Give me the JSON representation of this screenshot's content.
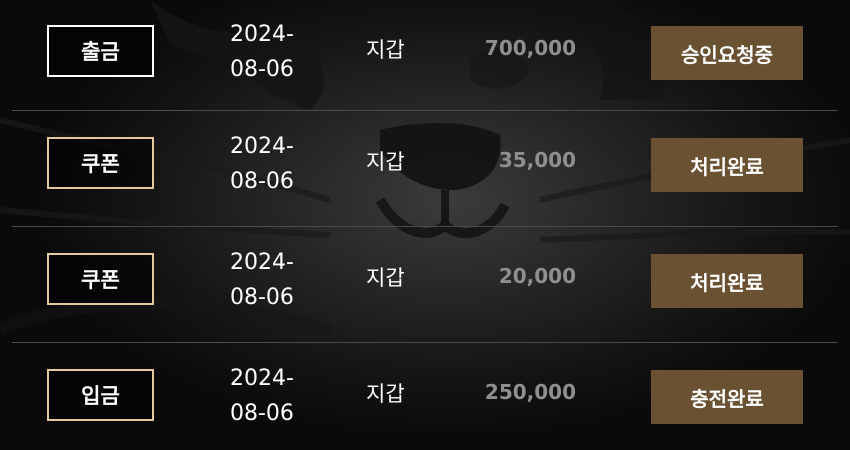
{
  "transactions": [
    {
      "type": "출금",
      "type_style": "white",
      "date": "2024-\n08-06",
      "source": "지갑",
      "amount": "700,000",
      "status": "승인요청중"
    },
    {
      "type": "쿠폰",
      "type_style": "gold",
      "date": "2024-\n08-06",
      "source": "지갑",
      "amount": "35,000",
      "status": "처리완료"
    },
    {
      "type": "쿠폰",
      "type_style": "gold",
      "date": "2024-\n08-06",
      "source": "지갑",
      "amount": "20,000",
      "status": "처리완료"
    },
    {
      "type": "입금",
      "type_style": "gold",
      "date": "2024-\n08-06",
      "source": "지갑",
      "amount": "250,000",
      "status": "충전완료"
    }
  ],
  "colors": {
    "status_button": "#6a5132",
    "badge_gold_border": "#e6c99a",
    "badge_white_border": "#ffffff",
    "amount_text": "#8f8f8f",
    "divider": "#4a4a4a"
  }
}
